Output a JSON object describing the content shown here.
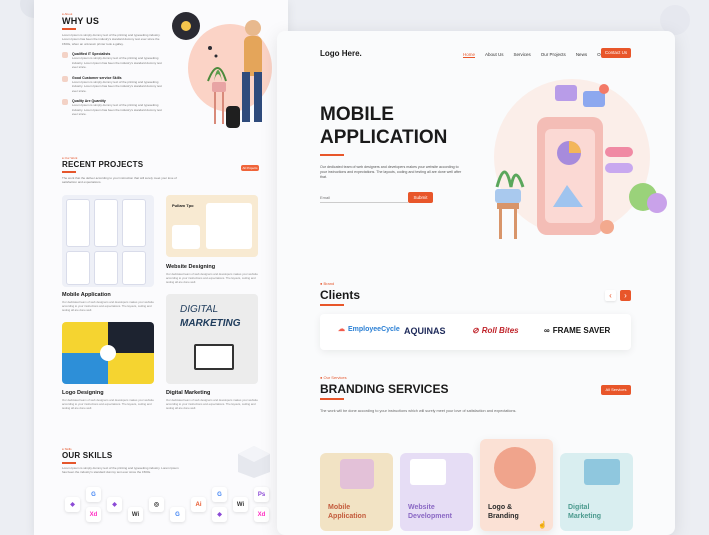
{
  "left_page": {
    "why_us": {
      "tag": "● About",
      "title": "WHY US",
      "intro": "Lorem Ipsum is simply dummy text of the printing and typesetting industry. Lorem Ipsum has been the industry's standard dummy text ever since the 1500s, when an unknown printer took a galley.",
      "features": [
        {
          "title": "Qualified IT Specialists",
          "desc": "Lorem Ipsum is simply dummy text of the printing and typesetting industry. Lorem Ipsum has been the industry's standard dummy text ever since."
        },
        {
          "title": "Good Customer service Skills",
          "desc": "Lorem Ipsum is simply dummy text of the printing and typesetting industry. Lorem Ipsum has been the industry's standard dummy text ever since."
        },
        {
          "title": "Quality Are Quantity",
          "desc": "Lorem Ipsum is simply dummy text of the printing and typesetting industry. Lorem Ipsum has been the industry's standard dummy text ever since."
        }
      ]
    },
    "projects": {
      "tag": "● Our Work",
      "title": "RECENT PROJECTS",
      "button": "All Projects",
      "intro": "The work that the deliver according to your instruction that will surely meet your love of satisfaction and expectations.",
      "items": [
        {
          "title": "Mobile Application",
          "desc": "Our dedicated team of web designers and developers makes your website according to your instructions and expectations. The layouts, coding and testing all are done well."
        },
        {
          "title": "Website Designing",
          "desc": "Our dedicated team of web designers and developers makes your website according to your instructions and expectations. The layouts, coding and testing all are done well."
        },
        {
          "title": "Logo Designing",
          "desc": "Our dedicated team of web designers and developers makes your website according to your instructions and expectations. The layouts, coding and testing all are done well."
        },
        {
          "title": "Digital Marketing",
          "desc": "Our dedicated team of web designers and developers makes your website according to your instructions and expectations. The layouts, coding and testing all are done well."
        }
      ],
      "marketing_art": {
        "line1": "DIGITAL",
        "line2": "MARKETING"
      },
      "web_art_title": "Pullam Tpo"
    },
    "skills": {
      "tag": "● Skills",
      "title": "OUR SKILLS",
      "intro": "Lorem Ipsum is simply dummy text of the printing and typesetting industry. Lorem Ipsum has been the industry's standard dummy text ever since the 1500s.",
      "icons": [
        "G",
        "Xd",
        "◆",
        "◎",
        "Ai",
        "Wi",
        "G",
        "Ps",
        "Xd",
        "◆",
        "G",
        "◆",
        "Ai",
        "Wi"
      ]
    }
  },
  "right_page": {
    "logo": "Logo Here.",
    "nav": [
      "Home",
      "About Us",
      "Services",
      "Our Projects",
      "News",
      "Our Clients"
    ],
    "contact_button": "Contact Us",
    "hero": {
      "title_line1": "MOBILE",
      "title_line2": "APPLICATION",
      "desc": "Our dedicated team of web designers and developers makes your website according to your instructions and expectations. The layouts, coding and testing all are done well after that.",
      "email_placeholder": "Email",
      "submit": "Submit"
    },
    "clients": {
      "tag": "● Brand",
      "title": "Clients",
      "logos": [
        "EmployeeCycle",
        "AQUINAS",
        "Roll Bites",
        "FRAME SAVER"
      ]
    },
    "branding": {
      "tag": "● Our Services",
      "title": "BRANDING SERVICES",
      "button": "All Services",
      "desc": "The work will be done according to your instructions which will surely meet your love of satisfaction and expectations.",
      "cards": [
        {
          "line1": "Mobile",
          "line2": "Application",
          "color": "#f2e3c4"
        },
        {
          "line1": "Website",
          "line2": "Development",
          "color": "#e6ddf5"
        },
        {
          "line1": "Logo &",
          "line2": "Branding",
          "color": "#fbe1d5"
        },
        {
          "line1": "Digital",
          "line2": "Marketing",
          "color": "#d9eef0"
        }
      ]
    }
  },
  "colors": {
    "accent": "#e8562a",
    "page_bg": "#eceef3"
  }
}
